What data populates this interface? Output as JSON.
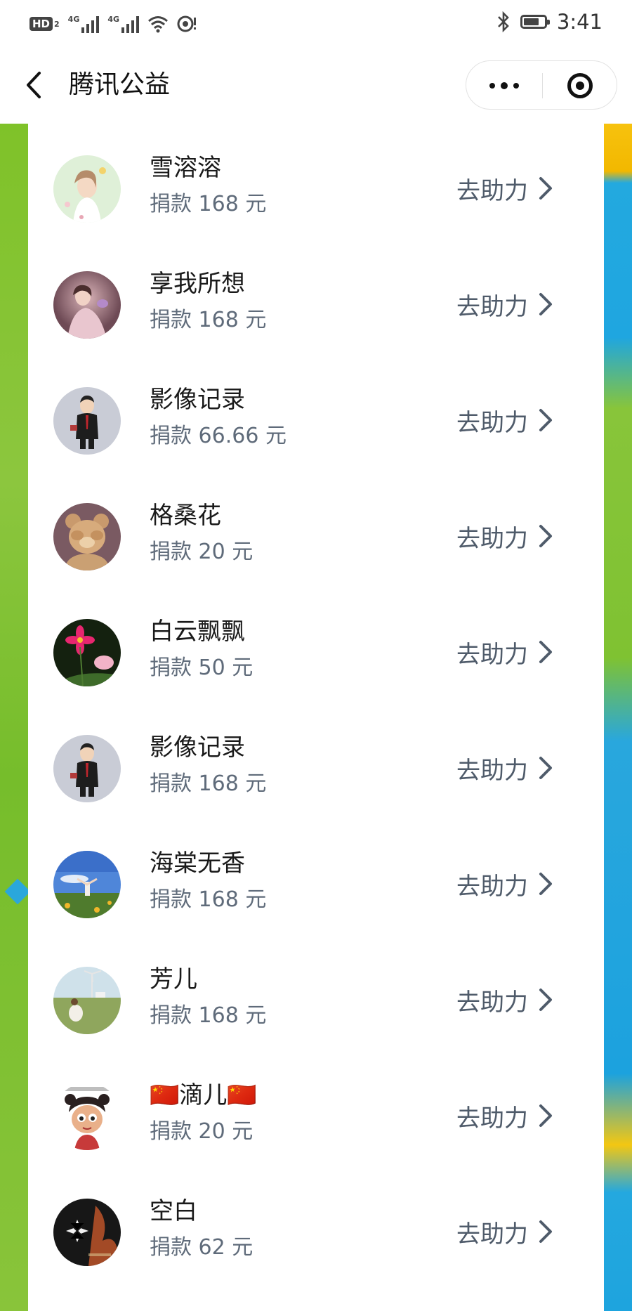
{
  "status_bar": {
    "hd_label": "HD",
    "hd_sub": "2",
    "net1": "4G",
    "net2": "4G",
    "time": "3:41",
    "battery_level": 0.75
  },
  "nav": {
    "title": "腾讯公益",
    "icons": {
      "back": "chevron-left-icon",
      "more": "more-dots-icon",
      "close": "mini-program-close-icon"
    }
  },
  "colors": {
    "name_text": "#1a1a1a",
    "sub_text": "#5f6b7a",
    "action_text": "#4f5b6a",
    "frame_green": "#7fc229",
    "frame_blue": "#1fa6e0",
    "frame_yellow": "#f2b800"
  },
  "donors": [
    {
      "name": "雪溶溶",
      "donation": "捐款 168 元",
      "action": "去助力",
      "avatar": "avatar-illustrated-girl"
    },
    {
      "name": "享我所想",
      "donation": "捐款 168 元",
      "action": "去助力",
      "avatar": "avatar-girl-photo"
    },
    {
      "name": "影像记录",
      "donation": "捐款 66.66 元",
      "action": "去助力",
      "avatar": "avatar-cartoon-man-suit"
    },
    {
      "name": "格桑花",
      "donation": "捐款 20 元",
      "action": "去助力",
      "avatar": "avatar-teddy-bear"
    },
    {
      "name": "白云飘飘",
      "donation": "捐款 50 元",
      "action": "去助力",
      "avatar": "avatar-pink-flower"
    },
    {
      "name": "影像记录",
      "donation": "捐款 168 元",
      "action": "去助力",
      "avatar": "avatar-cartoon-man-suit"
    },
    {
      "name": "海棠无香",
      "donation": "捐款 168 元",
      "action": "去助力",
      "avatar": "avatar-woman-sky-field"
    },
    {
      "name": "芳儿",
      "donation": "捐款 168 元",
      "action": "去助力",
      "avatar": "avatar-woman-grassland"
    },
    {
      "name": "🇨🇳滴儿🇨🇳",
      "donation": "捐款 20 元",
      "action": "去助力",
      "avatar": "avatar-cartoon-girl"
    },
    {
      "name": "空白",
      "donation": "捐款 62 元",
      "action": "去助力",
      "avatar": "avatar-dark-flower"
    }
  ]
}
